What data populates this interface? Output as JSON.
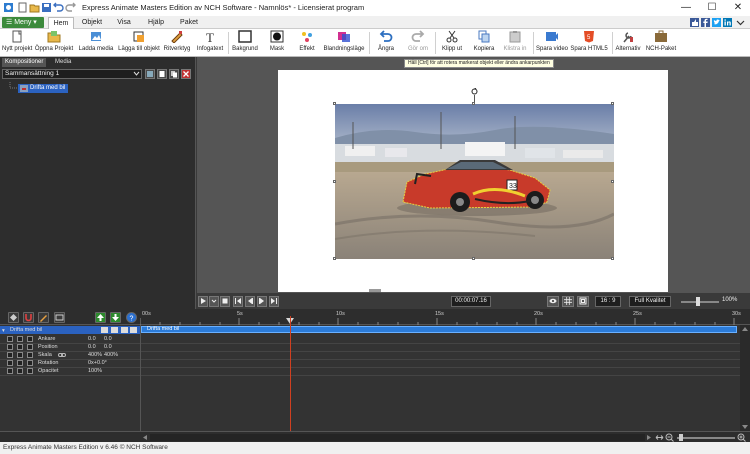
{
  "window": {
    "title": "Express Animate Masters Edition av NCH Software - Namnlös* - Licensierat program",
    "minimize": "—",
    "maximize": "☐",
    "close": "✕"
  },
  "menubar": {
    "menu_button": "☰ Meny ▾",
    "tabs": [
      {
        "label": "Hem"
      },
      {
        "label": "Objekt"
      },
      {
        "label": "Visa"
      },
      {
        "label": "Hjälp"
      },
      {
        "label": "Paket"
      }
    ]
  },
  "ribbon": {
    "buttons": [
      {
        "label": "Nytt projekt",
        "icon": "new-project-icon"
      },
      {
        "label": "Öppna Projekt",
        "icon": "open-project-icon"
      },
      {
        "label": "Ladda media",
        "icon": "load-media-icon"
      },
      {
        "label": "Lägga till objekt",
        "icon": "add-object-icon"
      },
      {
        "label": "Ritverktyg",
        "icon": "drawing-tool-icon"
      },
      {
        "label": "Infogatext",
        "icon": "insert-text-icon"
      },
      {
        "label": "Bakgrund",
        "icon": "background-icon"
      },
      {
        "label": "Mask",
        "icon": "mask-icon"
      },
      {
        "label": "Effekt",
        "icon": "effect-icon"
      },
      {
        "label": "Blandningsläge",
        "icon": "blend-mode-icon"
      },
      {
        "label": "Ångra",
        "icon": "undo-icon"
      },
      {
        "label": "Gör om",
        "icon": "redo-icon"
      },
      {
        "label": "Klipp ut",
        "icon": "cut-icon"
      },
      {
        "label": "Kopiera",
        "icon": "copy-icon"
      },
      {
        "label": "Klistra in",
        "icon": "paste-icon"
      },
      {
        "label": "Spara video",
        "icon": "save-video-icon"
      },
      {
        "label": "Spara HTML5",
        "icon": "save-html5-icon"
      },
      {
        "label": "Alternativ",
        "icon": "options-icon"
      },
      {
        "label": "NCH-Paket",
        "icon": "nch-suite-icon"
      }
    ]
  },
  "left_panel": {
    "tabs": [
      {
        "label": "Kompositioner"
      },
      {
        "label": "Media"
      }
    ],
    "composition_select": "Sammansättning 1",
    "tree_item": "Drifta med bil"
  },
  "canvas": {
    "tooltip": "Håll [Ctrl] för att rotera markerat objekt eller ändra ankarpunkten"
  },
  "transport": {
    "time": "00:00:07.16",
    "aspect": "16 : 9",
    "quality": "Full Kvalitet",
    "zoom": "100%"
  },
  "timeline": {
    "ticks": [
      "00s",
      "5s",
      "10s",
      "15s",
      "20s",
      "25s",
      "30s"
    ],
    "layer_name": "Drifta med bil",
    "clip_label": "Drifta med bil",
    "properties": [
      {
        "name": "Ankare",
        "v1": "0.0",
        "v2": "0.0"
      },
      {
        "name": "Position",
        "v1": "0.0",
        "v2": "0.0"
      },
      {
        "name": "Skala",
        "v1": "400%",
        "v2": "400%"
      },
      {
        "name": "Rotation",
        "v1": "0x+0.0°",
        "v2": ""
      },
      {
        "name": "Opacitet",
        "v1": "100%",
        "v2": ""
      }
    ]
  },
  "statusbar": {
    "text": "Express Animate Masters Edition v 6.46 © NCH Software"
  },
  "colors": {
    "accent_green": "#3c8a3c",
    "selection_blue": "#2b62c0",
    "clip_blue": "#2b7bd8",
    "playhead": "#d04020"
  }
}
